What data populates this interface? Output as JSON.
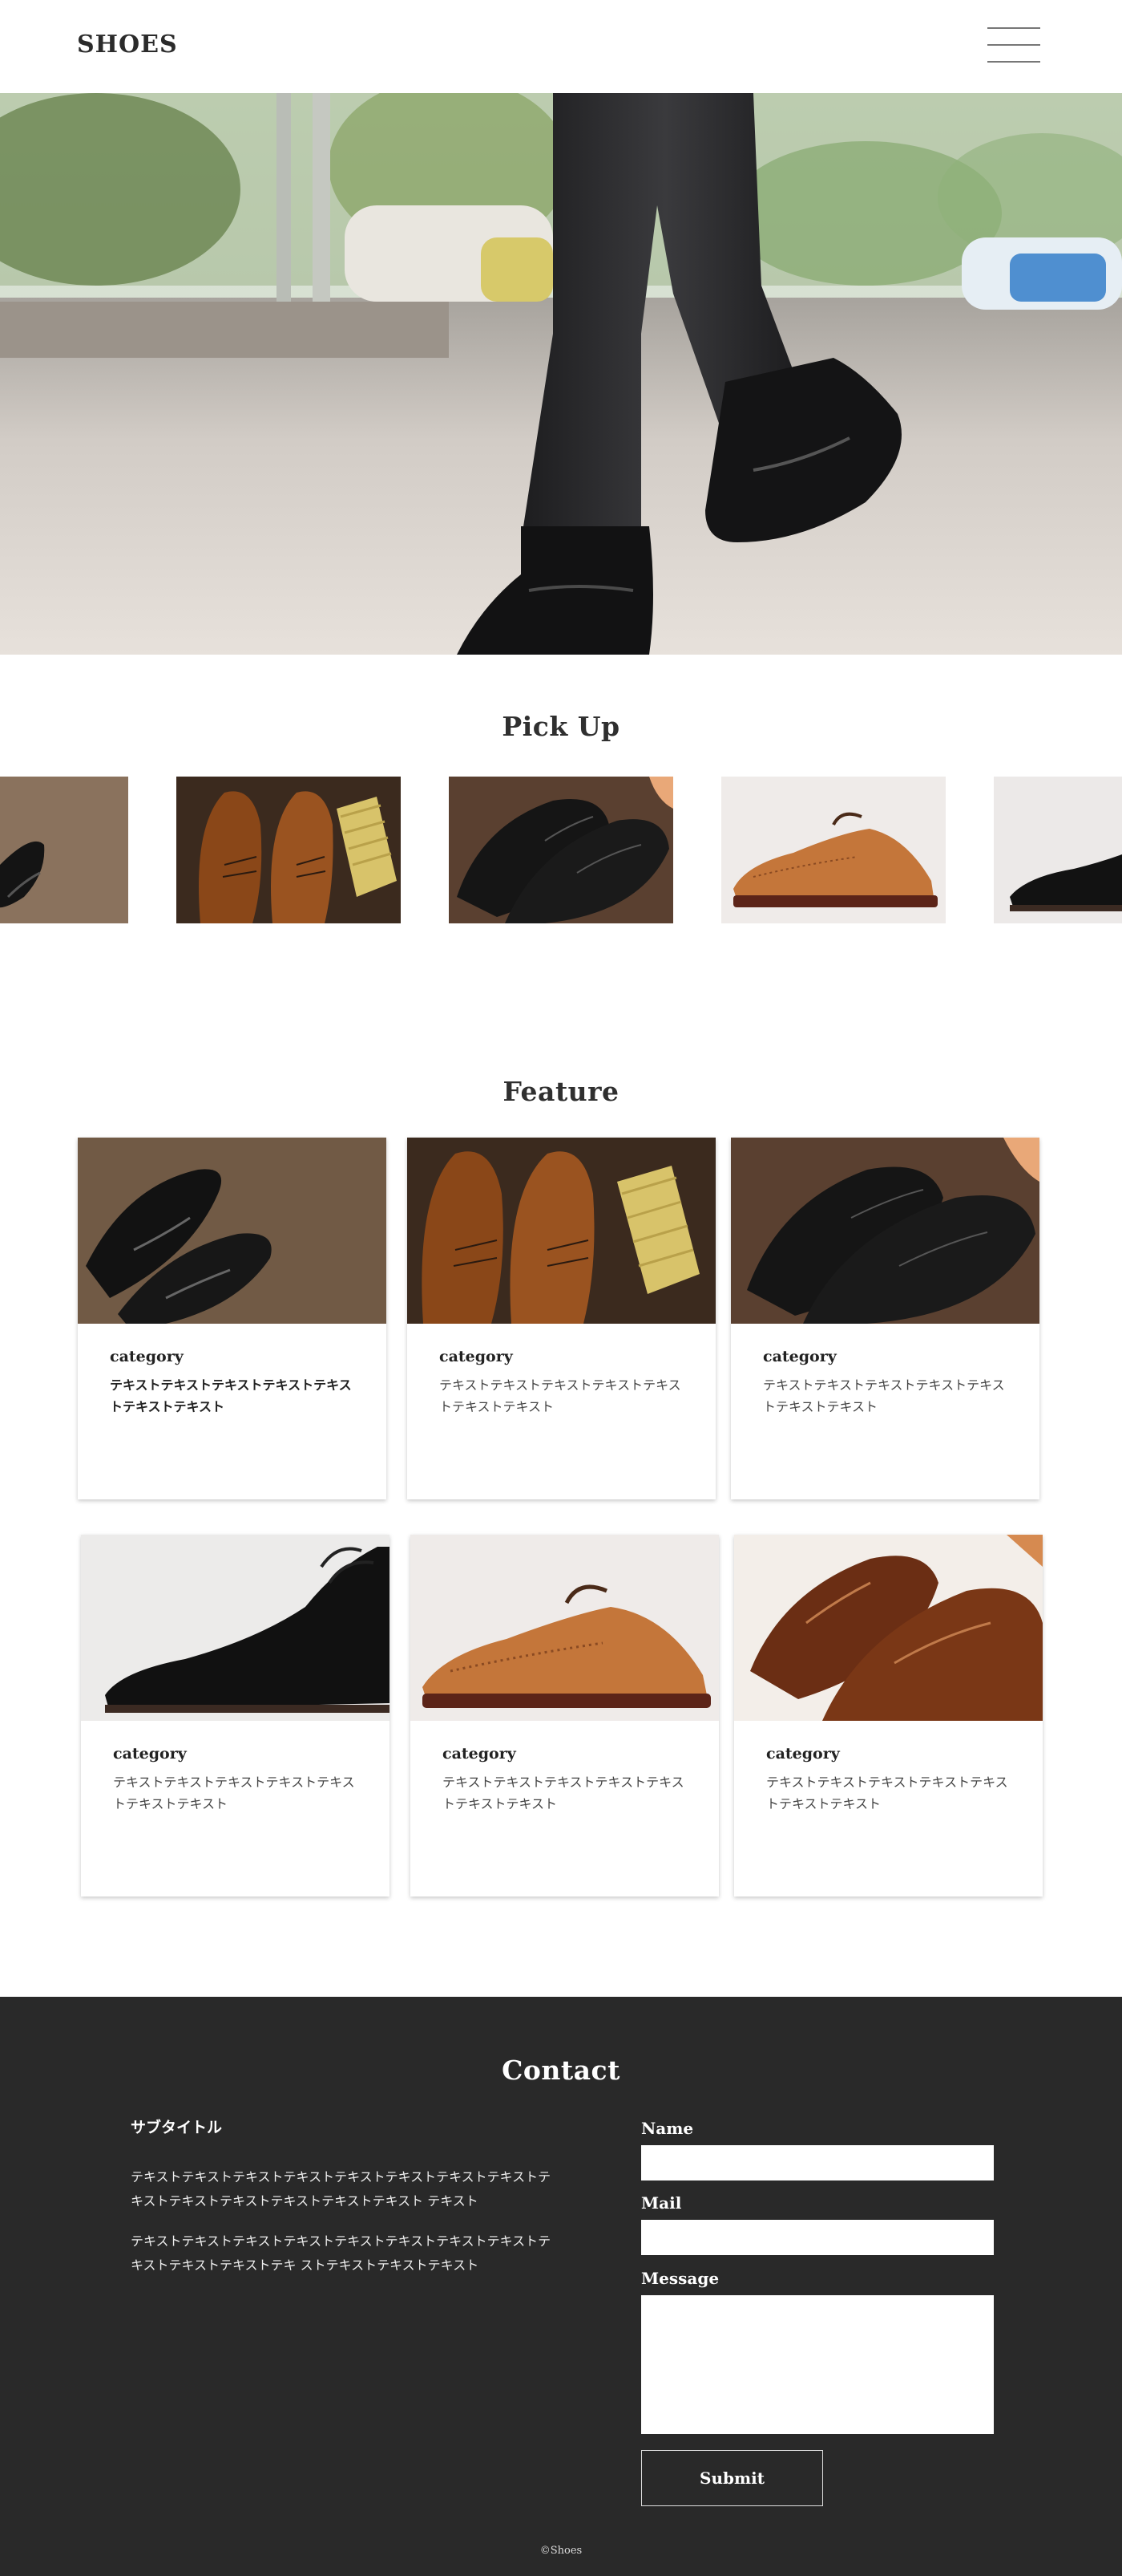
{
  "header": {
    "logo": "SHOES",
    "menu_icon": "hamburger-menu-icon"
  },
  "hero": {
    "image": "walking-boots-photo"
  },
  "pickup": {
    "title": "Pick Up",
    "items": [
      {
        "image": "black-oxford-shoes-photo"
      },
      {
        "image": "brown-oxfords-with-brush-photo"
      },
      {
        "image": "black-captoe-shoes-photo"
      },
      {
        "image": "tan-brogue-shoe-photo"
      },
      {
        "image": "black-brogue-shoe-photo"
      }
    ]
  },
  "feature": {
    "title": "Feature",
    "cards": [
      {
        "category": "category",
        "text": "テキストテキストテキストテキストテキストテキストテキスト",
        "image": "black-oxford-shoes-photo"
      },
      {
        "category": "category",
        "text": "テキストテキストテキストテキストテキストテキストテキスト",
        "image": "brown-oxfords-with-brush-photo"
      },
      {
        "category": "category",
        "text": "テキストテキストテキストテキストテキストテキストテキスト",
        "image": "black-captoe-shoes-photo"
      },
      {
        "category": "category",
        "text": "テキストテキストテキストテキストテキストテキストテキスト",
        "image": "black-brogue-shoe-photo"
      },
      {
        "category": "category",
        "text": "テキストテキストテキストテキストテキストテキストテキスト",
        "image": "tan-brogue-shoe-photo"
      },
      {
        "category": "category",
        "text": "テキストテキストテキストテキストテキストテキストテキスト",
        "image": "brown-captoe-shoes-photo"
      }
    ]
  },
  "contact": {
    "title": "Contact",
    "subtitle": "サブタイトル",
    "paragraph1": "テキストテキストテキストテキストテキストテキストテキストテキストテキストテキストテキストテキストテキストテキスト テキスト",
    "paragraph2": "テキストテキストテキストテキストテキストテキストテキストテキストテキストテキストテキストテキ ストテキストテキストテキスト",
    "name_label": "Name",
    "mail_label": "Mail",
    "message_label": "Message",
    "submit_label": "Submit",
    "copyright": "©Shoes"
  }
}
